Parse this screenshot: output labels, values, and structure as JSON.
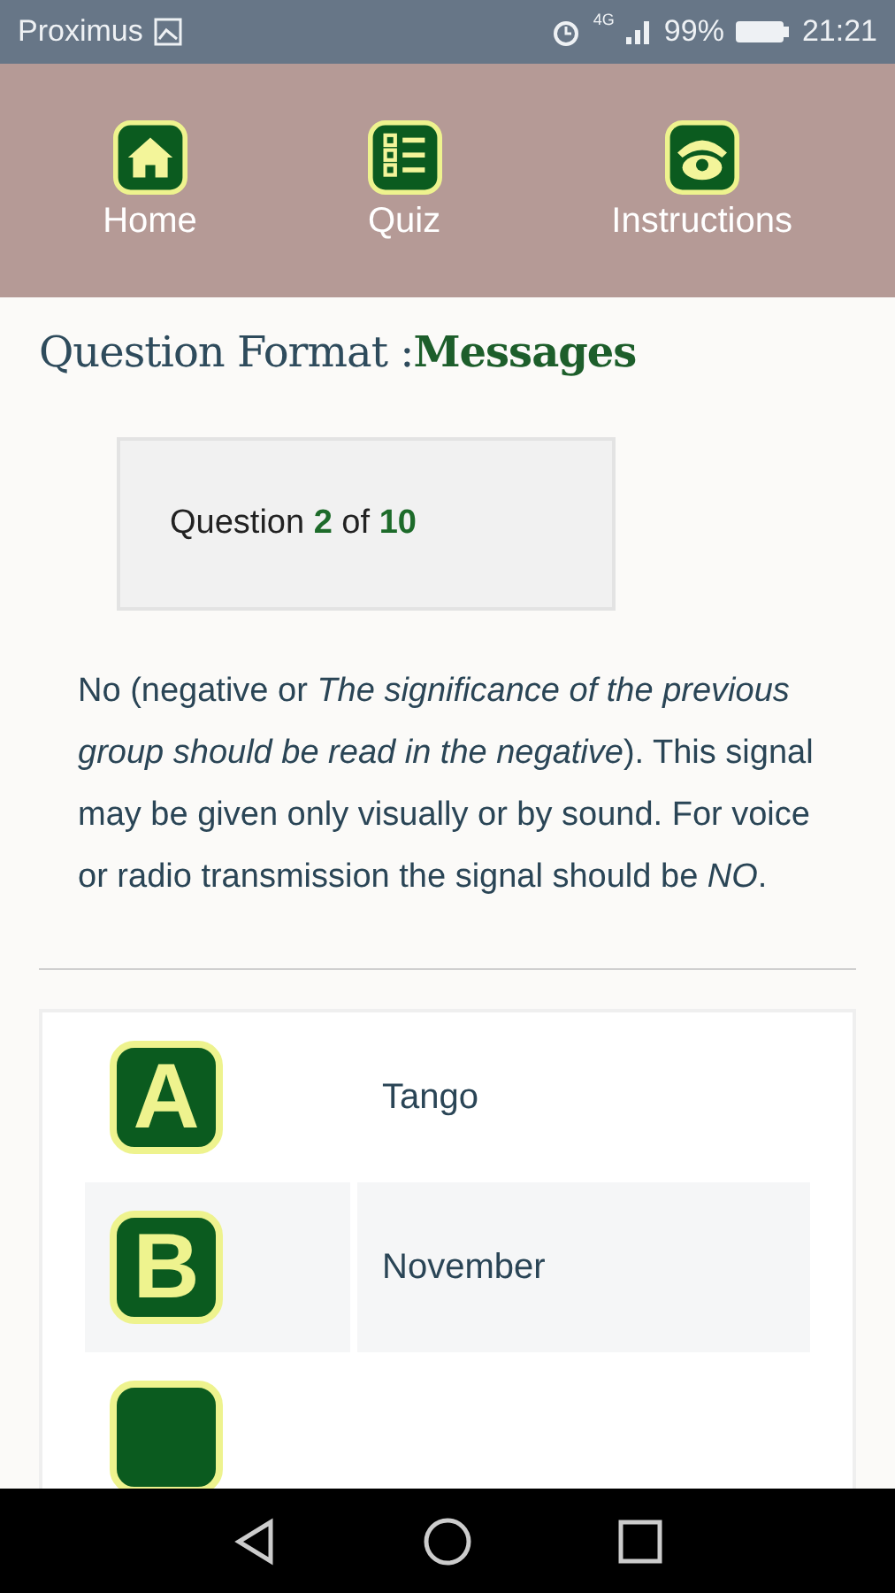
{
  "status_bar": {
    "carrier": "Proximus",
    "network": "4G",
    "battery": "99%",
    "time": "21:21"
  },
  "nav": [
    {
      "label": "Home"
    },
    {
      "label": "Quiz"
    },
    {
      "label": "Instructions"
    }
  ],
  "heading": "Question Format :**Messages**",
  "counter": "Question **2** of **10**",
  "description": "No (negative or *The significance of the previous group should be read in the negative*). This signal may be given only visually or by sound. For voice or radio transmission the signal should be *NO*.",
  "options": [
    {
      "kind": "full",
      "letter": "A",
      "answer": "Tango"
    },
    {
      "kind": "full",
      "letter": "B",
      "answer": "November"
    },
    {
      "kind": "cut"
    }
  ]
}
